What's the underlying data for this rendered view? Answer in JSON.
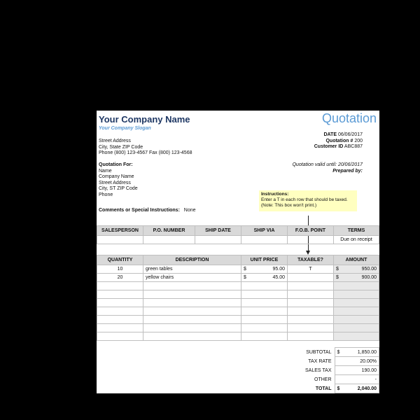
{
  "header": {
    "company_name": "Your Company Name",
    "slogan": "Your Company Slogan",
    "doc_title": "Quotation",
    "address_lines": [
      "Street Address",
      "City, State ZIP Code",
      "Phone (800) 123-4567   Fax (800) 123-4568"
    ],
    "date_label": "DATE",
    "date_value": "06/06/2017",
    "quote_label": "Quotation #",
    "quote_value": "200",
    "customer_label": "Customer ID",
    "customer_value": "ABC887"
  },
  "quote_for": {
    "label": "Quotation For:",
    "lines": [
      "Name",
      "Company Name",
      "Street Address",
      "City, ST  ZIP Code",
      "Phone"
    ],
    "valid_label": "Quotation valid until:",
    "valid_value": "20/06/2017",
    "prepared_label": "Prepared by:"
  },
  "instructions": {
    "title": "Instructions:",
    "text": "Enter a T in each row that should be taxed.  (Note: This box won't print.)"
  },
  "comments": {
    "label": "Comments or Special Instructions:",
    "value": "None"
  },
  "shipping": {
    "headers": [
      "SALESPERSON",
      "P.O. NUMBER",
      "SHIP DATE",
      "SHIP VIA",
      "F.O.B. POINT",
      "TERMS"
    ],
    "values": [
      "",
      "",
      "",
      "",
      "",
      "Due on receipt"
    ]
  },
  "items": {
    "headers": [
      "QUANTITY",
      "DESCRIPTION",
      "UNIT PRICE",
      "TAXABLE?",
      "AMOUNT"
    ],
    "currency": "$",
    "rows": [
      {
        "qty": "10",
        "desc": "green tables",
        "unit": "95.00",
        "tax": "T",
        "amount": "950.00"
      },
      {
        "qty": "20",
        "desc": "yellow chairs",
        "unit": "45.00",
        "tax": "",
        "amount": "900.00"
      },
      {
        "qty": "",
        "desc": "",
        "unit": "",
        "tax": "",
        "amount": ""
      },
      {
        "qty": "",
        "desc": "",
        "unit": "",
        "tax": "",
        "amount": ""
      },
      {
        "qty": "",
        "desc": "",
        "unit": "",
        "tax": "",
        "amount": ""
      },
      {
        "qty": "",
        "desc": "",
        "unit": "",
        "tax": "",
        "amount": ""
      },
      {
        "qty": "",
        "desc": "",
        "unit": "",
        "tax": "",
        "amount": ""
      },
      {
        "qty": "",
        "desc": "",
        "unit": "",
        "tax": "",
        "amount": ""
      },
      {
        "qty": "",
        "desc": "",
        "unit": "",
        "tax": "",
        "amount": ""
      }
    ]
  },
  "totals": {
    "subtotal_label": "SUBTOTAL",
    "subtotal_value": "1,850.00",
    "taxrate_label": "TAX RATE",
    "taxrate_value": "20.00%",
    "salestax_label": "SALES TAX",
    "salestax_value": "190.00",
    "other_label": "OTHER",
    "other_value": "-",
    "total_label": "TOTAL",
    "total_value": "2,040.00"
  },
  "colors": {
    "title_blue": "#1f3864",
    "accent_blue": "#5b9bd5",
    "header_gray": "#d9d9d9",
    "note_yellow": "#ffffc0"
  }
}
